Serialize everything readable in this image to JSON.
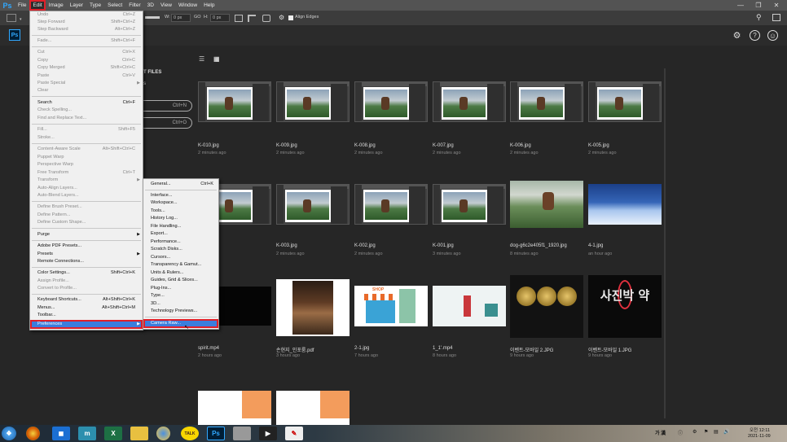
{
  "app": {
    "name": "Ps"
  },
  "menubar": {
    "items": [
      "File",
      "Edit",
      "Image",
      "Layer",
      "Type",
      "Select",
      "Filter",
      "3D",
      "View",
      "Window",
      "Help"
    ],
    "active": "Edit"
  },
  "optbar": {
    "w_label": "W:",
    "w_value": "0 px",
    "go_label": "GO",
    "h_label": "H:",
    "h_value": "0 px",
    "align_edges": "Align Edges"
  },
  "sidebar": {
    "recent_label": "T FILES",
    "s_text": "s",
    "pill1": "Ctrl+N",
    "pill2": "Ctrl+O"
  },
  "files": [
    {
      "name": "K-010.jpg",
      "time": "2 minutes ago"
    },
    {
      "name": "K-009.jpg",
      "time": "2 minutes ago"
    },
    {
      "name": "K-008.jpg",
      "time": "2 minutes ago"
    },
    {
      "name": "K-007.jpg",
      "time": "2 minutes ago"
    },
    {
      "name": "K-006.jpg",
      "time": "2 minutes ago"
    },
    {
      "name": "K-005.jpg",
      "time": "2 minutes ago"
    },
    {
      "name": "",
      "time": ""
    },
    {
      "name": "K-003.jpg",
      "time": "2 minutes ago"
    },
    {
      "name": "K-002.jpg",
      "time": "2 minutes ago"
    },
    {
      "name": "K-001.jpg",
      "time": "3 minutes ago"
    },
    {
      "name": "dog-g6c2e405f1_1920.jpg",
      "time": "8 minutes ago"
    },
    {
      "name": "4-1.jpg",
      "time": "an hour ago"
    },
    {
      "name": "spirit.mp4",
      "time": "2 hours ago"
    },
    {
      "name": "손현지_인포룸.pdf",
      "time": "3 hours ago"
    },
    {
      "name": "2-1.jpg",
      "time": "7 hours ago"
    },
    {
      "name": "1_1'.mp4",
      "time": "8 hours ago"
    },
    {
      "name": "이벤트-모바일 2.JPG",
      "time": "9 hours ago"
    },
    {
      "name": "이벤트-모바일 1.JPG",
      "time": "9 hours ago"
    }
  ],
  "thumb_text": {
    "event": "사진박 약",
    "shop_sign": "SHOP"
  },
  "edit_menu": [
    {
      "label": "Undo",
      "shortcut": "Ctrl+Z",
      "disabled": true
    },
    {
      "label": "Step Forward",
      "shortcut": "Shift+Ctrl+Z",
      "disabled": true
    },
    {
      "label": "Step Backward",
      "shortcut": "Alt+Ctrl+Z",
      "disabled": true
    },
    {
      "label": "Fade...",
      "shortcut": "Shift+Ctrl+F",
      "disabled": true
    },
    {
      "label": "Cut",
      "shortcut": "Ctrl+X",
      "disabled": true
    },
    {
      "label": "Copy",
      "shortcut": "Ctrl+C",
      "disabled": true
    },
    {
      "label": "Copy Merged",
      "shortcut": "Shift+Ctrl+C",
      "disabled": true
    },
    {
      "label": "Paste",
      "shortcut": "Ctrl+V",
      "disabled": true
    },
    {
      "label": "Paste Special",
      "shortcut": "",
      "disabled": true,
      "submenu": true
    },
    {
      "label": "Clear",
      "shortcut": "",
      "disabled": true
    },
    {
      "label": "Search",
      "shortcut": "Ctrl+F",
      "disabled": false
    },
    {
      "label": "Check Spelling...",
      "shortcut": "",
      "disabled": true
    },
    {
      "label": "Find and Replace Text...",
      "shortcut": "",
      "disabled": true
    },
    {
      "label": "Fill...",
      "shortcut": "Shift+F5",
      "disabled": true
    },
    {
      "label": "Stroke...",
      "shortcut": "",
      "disabled": true
    },
    {
      "label": "Content-Aware Scale",
      "shortcut": "Alt+Shift+Ctrl+C",
      "disabled": true
    },
    {
      "label": "Puppet Warp",
      "shortcut": "",
      "disabled": true
    },
    {
      "label": "Perspective Warp",
      "shortcut": "",
      "disabled": true
    },
    {
      "label": "Free Transform",
      "shortcut": "Ctrl+T",
      "disabled": true
    },
    {
      "label": "Transform",
      "shortcut": "",
      "disabled": true,
      "submenu": true
    },
    {
      "label": "Auto-Align Layers...",
      "shortcut": "",
      "disabled": true
    },
    {
      "label": "Auto-Blend Layers...",
      "shortcut": "",
      "disabled": true
    },
    {
      "label": "Define Brush Preset...",
      "shortcut": "",
      "disabled": true
    },
    {
      "label": "Define Pattern...",
      "shortcut": "",
      "disabled": true
    },
    {
      "label": "Define Custom Shape...",
      "shortcut": "",
      "disabled": true
    },
    {
      "label": "Purge",
      "shortcut": "",
      "disabled": false,
      "submenu": true
    },
    {
      "label": "Adobe PDF Presets...",
      "shortcut": "",
      "disabled": false
    },
    {
      "label": "Presets",
      "shortcut": "",
      "disabled": false,
      "submenu": true
    },
    {
      "label": "Remote Connections...",
      "shortcut": "",
      "disabled": false
    },
    {
      "label": "Color Settings...",
      "shortcut": "Shift+Ctrl+K",
      "disabled": false
    },
    {
      "label": "Assign Profile...",
      "shortcut": "",
      "disabled": true
    },
    {
      "label": "Convert to Profile...",
      "shortcut": "",
      "disabled": true
    },
    {
      "label": "Keyboard Shortcuts...",
      "shortcut": "Alt+Shift+Ctrl+K",
      "disabled": false
    },
    {
      "label": "Menus...",
      "shortcut": "Alt+Shift+Ctrl+M",
      "disabled": false
    },
    {
      "label": "Toolbar...",
      "shortcut": "",
      "disabled": false
    },
    {
      "label": "Preferences",
      "shortcut": "",
      "disabled": false,
      "submenu": true,
      "highlighted": true
    }
  ],
  "pref_menu": [
    {
      "label": "General...",
      "shortcut": "Ctrl+K"
    },
    {
      "label": "Interface...",
      "shortcut": ""
    },
    {
      "label": "Workspace...",
      "shortcut": ""
    },
    {
      "label": "Tools...",
      "shortcut": ""
    },
    {
      "label": "History Log...",
      "shortcut": ""
    },
    {
      "label": "File Handling...",
      "shortcut": ""
    },
    {
      "label": "Export...",
      "shortcut": ""
    },
    {
      "label": "Performance...",
      "shortcut": ""
    },
    {
      "label": "Scratch Disks...",
      "shortcut": ""
    },
    {
      "label": "Cursors...",
      "shortcut": ""
    },
    {
      "label": "Transparency & Gamut...",
      "shortcut": ""
    },
    {
      "label": "Units & Rulers...",
      "shortcut": ""
    },
    {
      "label": "Guides, Grid & Slices...",
      "shortcut": ""
    },
    {
      "label": "Plug-Ins...",
      "shortcut": ""
    },
    {
      "label": "Type...",
      "shortcut": ""
    },
    {
      "label": "3D...",
      "shortcut": ""
    },
    {
      "label": "Technology Previews...",
      "shortcut": ""
    },
    {
      "label": "Camera Raw...",
      "shortcut": "",
      "highlighted": true
    }
  ],
  "taskbar": {
    "ime": "가 漢",
    "time": "오전 12:11",
    "date": "2021-11-09"
  },
  "colors": {
    "accent": "#31a8ff",
    "highlight": "#3b7ddd",
    "redbox": "#e0202a",
    "bg": "#262626"
  }
}
